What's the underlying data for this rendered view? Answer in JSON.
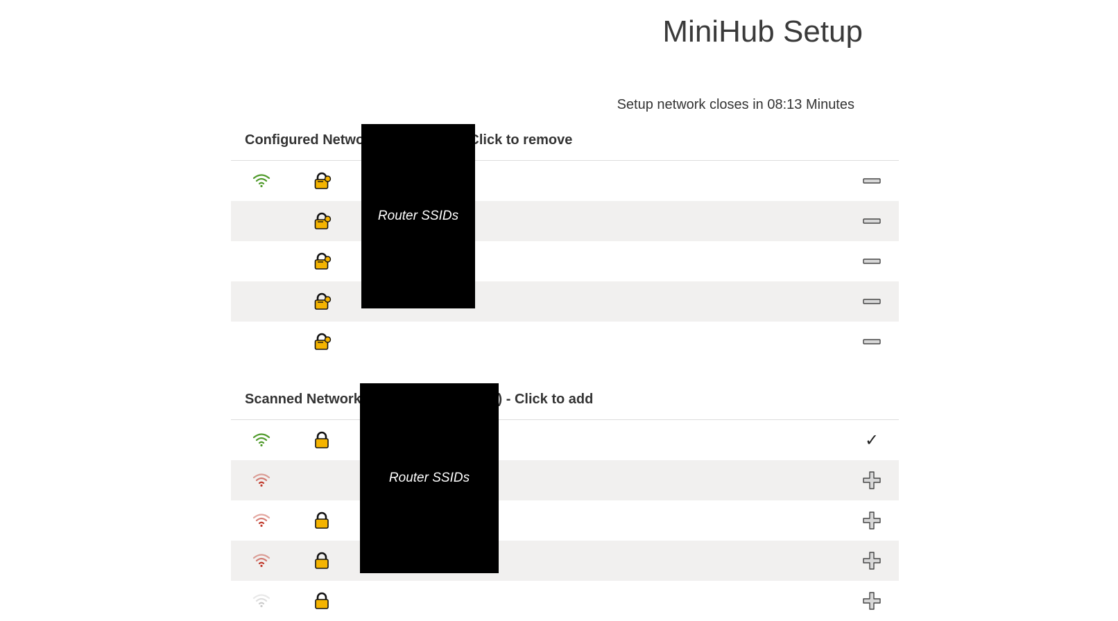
{
  "page": {
    "title": "MiniHub Setup",
    "countdown": "Setup network closes in 08:13 Minutes"
  },
  "configured": {
    "heading": "Configured Networks (5 / 8 max) - Click to remove",
    "redaction_label": "Router SSIDs",
    "rows": [
      {
        "signal": "strong",
        "secured": true,
        "lock_state": "unlocked-partial",
        "action": "remove"
      },
      {
        "signal": "none",
        "secured": true,
        "lock_state": "unlocked-partial",
        "action": "remove"
      },
      {
        "signal": "none",
        "secured": true,
        "lock_state": "unlocked-partial",
        "action": "remove"
      },
      {
        "signal": "none",
        "secured": true,
        "lock_state": "unlocked-partial",
        "action": "remove"
      },
      {
        "signal": "none",
        "secured": true,
        "lock_state": "unlocked-partial",
        "action": "remove"
      }
    ]
  },
  "scanned": {
    "heading": "Scanned Networks (01:21 Minutes ago) - Click to add",
    "redaction_label": "Router SSIDs",
    "rows": [
      {
        "signal": "strong",
        "secured": true,
        "action": "added",
        "action_glyph": "✓"
      },
      {
        "signal": "weak",
        "secured": false,
        "action": "add"
      },
      {
        "signal": "weak",
        "secured": true,
        "action": "add"
      },
      {
        "signal": "weak",
        "secured": true,
        "action": "add"
      },
      {
        "signal": "very-weak",
        "secured": true,
        "action": "add"
      }
    ]
  },
  "colors": {
    "signal_strong": "#4f9a2a",
    "signal_weak": "#c0392b",
    "signal_very_weak": "#cccccc",
    "lock_fill": "#f5b400",
    "row_alt": "#f1f0ef"
  }
}
